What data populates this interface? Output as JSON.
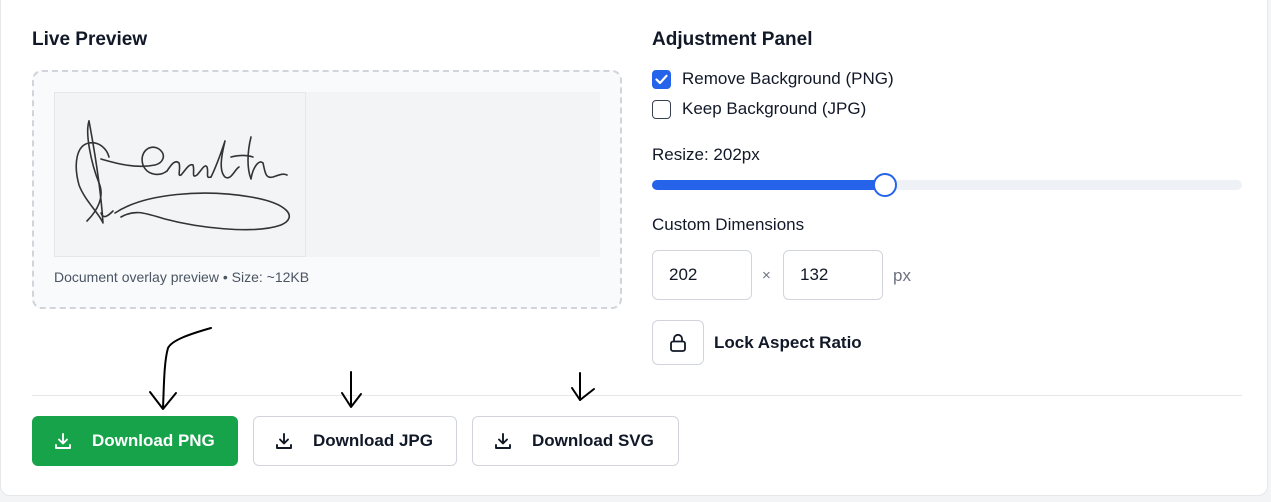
{
  "preview": {
    "title": "Live Preview",
    "caption": "Document overlay preview • Size: ~12KB"
  },
  "adjustment": {
    "title": "Adjustment Panel",
    "options": [
      {
        "label": "Remove Background (PNG)",
        "checked": true
      },
      {
        "label": "Keep Background (JPG)",
        "checked": false
      }
    ],
    "resize_label": "Resize: 202px",
    "resize_fraction": 0.395,
    "dims_label": "Custom Dimensions",
    "width_value": "202",
    "height_value": "132",
    "times_symbol": "×",
    "unit": "px",
    "lock_label": "Lock Aspect Ratio"
  },
  "downloads": {
    "png": "Download PNG",
    "jpg": "Download JPG",
    "svg": "Download SVG"
  },
  "colors": {
    "accent": "#2563eb",
    "download_primary": "#16a34a"
  }
}
